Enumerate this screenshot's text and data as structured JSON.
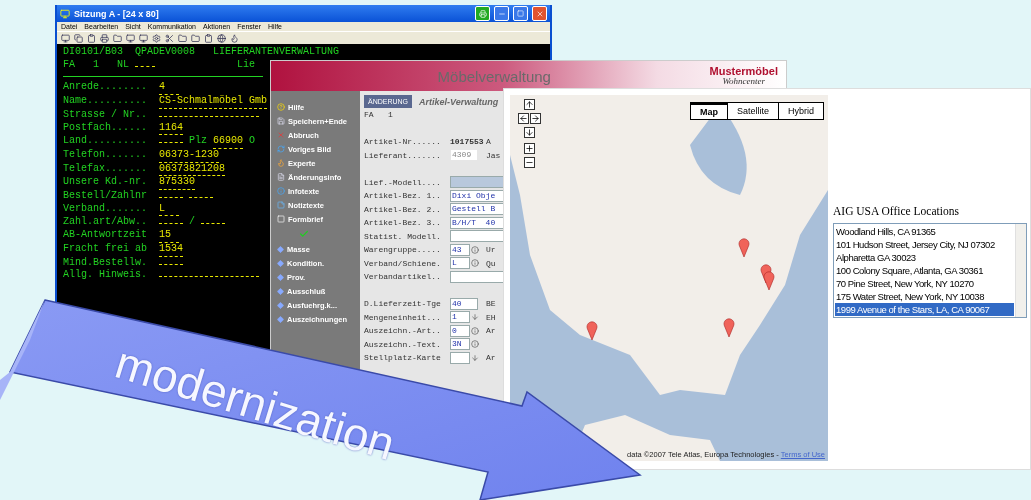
{
  "terminal": {
    "title": "Sitzung A - [24 x 80]",
    "menu": [
      "Datei",
      "Bearbeiten",
      "Sicht",
      "Kommunikation",
      "Aktionen",
      "Fenster",
      "Hilfe"
    ],
    "header": [
      "DI0101/B03  QPADEV0008   LIEFERANTENVERWALTUNG"
    ],
    "subheader": {
      "text": "FA   1   NL",
      "cut": "Lie"
    },
    "rows": [
      {
        "label": "Anrede........",
        "parts": [
          {
            "kind": "input",
            "text": "4"
          }
        ]
      },
      {
        "label": "Name..........",
        "parts": [
          {
            "kind": "input",
            "text": "CS-Schmalmöbel Gmb"
          }
        ]
      },
      {
        "label": "Strasse / Nr..",
        "parts": [
          {
            "kind": "blank-wide"
          }
        ]
      },
      {
        "label": "Postfach......",
        "parts": [
          {
            "kind": "input",
            "text": "1164"
          }
        ]
      },
      {
        "label": "Land..........",
        "parts": [
          {
            "kind": "blank"
          },
          {
            "kind": "label",
            "text": "Plz"
          },
          {
            "kind": "input",
            "text": "66900"
          },
          {
            "kind": "label",
            "text": "O"
          }
        ]
      },
      {
        "label": "Telefon.......",
        "parts": [
          {
            "kind": "input",
            "text": "06373-1230"
          }
        ]
      },
      {
        "label": "Telefax.......",
        "parts": [
          {
            "kind": "input",
            "text": "06373821208"
          }
        ]
      },
      {
        "label": "Unsere Kd.-nr.",
        "parts": [
          {
            "kind": "input",
            "text": "875330"
          }
        ]
      },
      {
        "label": "Bestell/Zahlnr",
        "parts": [
          {
            "kind": "blank"
          },
          {
            "kind": "blank"
          }
        ]
      },
      {
        "label": "Verband.......",
        "parts": [
          {
            "kind": "input",
            "text": "L"
          }
        ]
      },
      {
        "label": "Zahl.art/Abw..",
        "parts": [
          {
            "kind": "blank"
          },
          {
            "kind": "label",
            "text": "/"
          },
          {
            "kind": "blank"
          }
        ]
      },
      {
        "label": "AB-Antwortzeit",
        "parts": [
          {
            "kind": "input",
            "text": "15"
          }
        ]
      },
      {
        "label": "Fracht frei ab",
        "parts": [
          {
            "kind": "input",
            "text": "1534"
          }
        ]
      },
      {
        "label": "Mind.Bestellw.",
        "parts": [
          {
            "kind": "blank"
          }
        ]
      },
      {
        "label": "Allg. Hinweis.",
        "parts": [
          {
            "kind": "blank-wide"
          }
        ]
      }
    ]
  },
  "app": {
    "title": "Möbelverwaltung",
    "logo": "Mustermöbel",
    "logo_sub": "Wohncenter",
    "menu": [
      "Hilfe",
      "Speichern+Ende",
      "Abbruch",
      "Voriges Bild",
      "Experte",
      "Änderungsinfo",
      "Infotexte",
      "Notiztexte",
      "Formbrief"
    ],
    "submenu": [
      "Masse",
      "Kondition.",
      "Prov.",
      "Ausschluß",
      "Ausfuehrg.k...",
      "Auszeichnungen"
    ],
    "badge": "ÄNDERUNG",
    "form_title": "Artikel-Verwaltung",
    "fa": "FA   1",
    "fields": [
      {
        "label": "Artikel-Nr......",
        "kind": "text",
        "value": "1017553",
        "aside": "A"
      },
      {
        "label": "Lieferant.......",
        "kind": "disabled",
        "value": "4309",
        "aside": "Jas"
      },
      {
        "kind": "gap"
      },
      {
        "label": "Lief.-Modell....",
        "kind": "focused"
      },
      {
        "label": "Artikel-Bez. 1..",
        "kind": "input",
        "value": "Dixi Obje"
      },
      {
        "label": "Artikel-Bez. 2..",
        "kind": "input",
        "value": "Gestell B"
      },
      {
        "label": "Artikel-Bez. 3..",
        "kind": "input",
        "value": "B/H/T  40"
      },
      {
        "label": "Statist. Modell.",
        "kind": "input"
      },
      {
        "label": "Warengruppe.....",
        "kind": "info",
        "value": "43",
        "aside": "Ur"
      },
      {
        "label": "Verband/Schiene.",
        "kind": "info",
        "value": "L",
        "aside": "Qu"
      },
      {
        "label": "Verbandartikel..",
        "kind": "input"
      },
      {
        "kind": "gap"
      },
      {
        "label": "D.Lieferzeit-Tge",
        "kind": "short",
        "value": "40",
        "aside": "BE"
      },
      {
        "label": "Mengeneinheit...",
        "kind": "select",
        "value": "1",
        "aside": "EH"
      },
      {
        "label": "Auszeichn.-Art..",
        "kind": "info",
        "value": "0",
        "aside": "Ar"
      },
      {
        "label": "Auszeichn.-Text.",
        "kind": "info",
        "value": "3N"
      },
      {
        "label": "Stellplatz-Karte",
        "kind": "select",
        "aside": "Ar"
      }
    ]
  },
  "map": {
    "types": [
      {
        "label": "Map",
        "selected": true
      },
      {
        "label": "Satellite",
        "selected": false
      },
      {
        "label": "Hybrid",
        "selected": false
      }
    ],
    "attribution": "data ©2007 Tele Atlas, Europa Technologies - ",
    "terms": "Terms of Use"
  },
  "locations": {
    "heading": "AIG USA Office Locations",
    "items": [
      {
        "label": "Woodland Hills, CA 91365",
        "selected": false
      },
      {
        "label": "101 Hudson Street, Jersey City, NJ 07302",
        "selected": false
      },
      {
        "label": "Alpharetta GA 30023",
        "selected": false
      },
      {
        "label": "100 Colony Square, Atlanta, GA 30361",
        "selected": false
      },
      {
        "label": "70 Pine Street, New York, NY 10270",
        "selected": false
      },
      {
        "label": "175 Water Street, New York, NY 10038",
        "selected": false
      },
      {
        "label": "1999 Avenue of the Stars, LA, CA 90067",
        "selected": true
      }
    ]
  },
  "arrow": {
    "label": "modernization"
  }
}
